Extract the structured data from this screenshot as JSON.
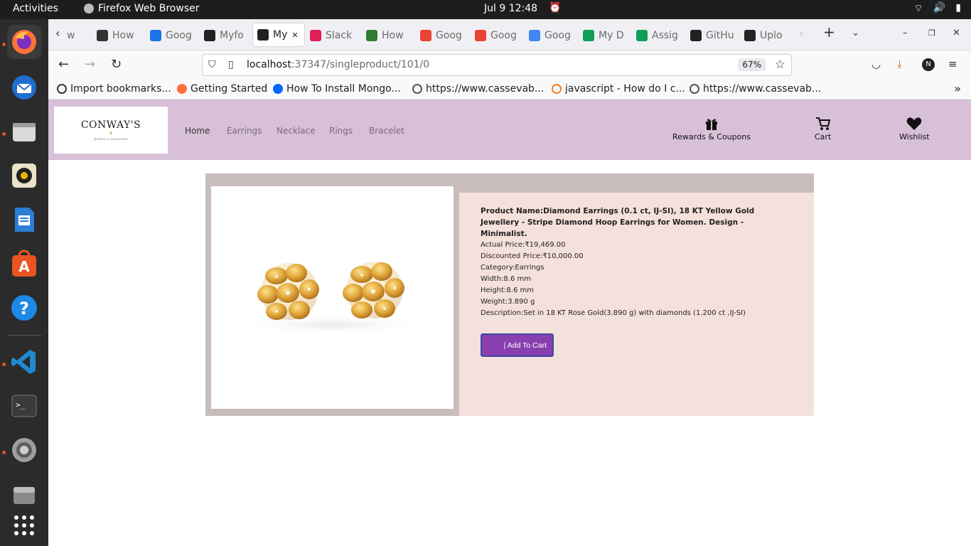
{
  "system": {
    "activities": "Activities",
    "app_name": "Firefox Web Browser",
    "clock": "Jul 9  12:48"
  },
  "browser": {
    "tabs": [
      {
        "label": "w",
        "icon": "chevron-left-icon",
        "color": "#f0f0f4"
      },
      {
        "label": "How",
        "icon": "hex-icon",
        "color": "#333333"
      },
      {
        "label": "Goog",
        "icon": "meet-icon",
        "color": "#1a73e8"
      },
      {
        "label": "Myfo",
        "icon": "angular-icon",
        "color": "#222222"
      },
      {
        "label": "My",
        "icon": "angular-icon",
        "color": "#222222",
        "active": true
      },
      {
        "label": "Slack",
        "icon": "slack-icon",
        "color": "#e01e5a"
      },
      {
        "label": "How",
        "icon": "dg-icon",
        "color": "#2e7d32"
      },
      {
        "label": "Goog",
        "icon": "chrome-icon",
        "color": "#ea4335"
      },
      {
        "label": "Goog",
        "icon": "chrome-icon",
        "color": "#ea4335"
      },
      {
        "label": "Goog",
        "icon": "google-icon",
        "color": "#4285f4"
      },
      {
        "label": "My D",
        "icon": "drive-icon",
        "color": "#0f9d58"
      },
      {
        "label": "Assig",
        "icon": "sheets-icon",
        "color": "#0f9d58"
      },
      {
        "label": "GitHu",
        "icon": "github-icon",
        "color": "#222222"
      },
      {
        "label": "Uplo",
        "icon": "github-icon",
        "color": "#222222"
      }
    ],
    "url_host": "localhost",
    "url_path": ":37347/singleproduct/101/0",
    "zoom": "67%",
    "bookmarks": [
      {
        "label": "Import bookmarks...",
        "icon": "import-icon",
        "color": "#333333"
      },
      {
        "label": "Getting Started",
        "icon": "firefox-icon",
        "color": "#ff7139"
      },
      {
        "label": "How To Install Mongo...",
        "icon": "digitalocean-icon",
        "color": "#0069ff"
      },
      {
        "label": "https://www.cassevab...",
        "icon": "globe-icon",
        "color": "#555555"
      },
      {
        "label": "javascript - How do I c...",
        "icon": "stackoverflow-icon",
        "color": "#f48024"
      },
      {
        "label": "https://www.cassevab...",
        "icon": "globe-icon",
        "color": "#555555"
      }
    ]
  },
  "site": {
    "logo_brand": "CONWAY'S",
    "logo_tagline": "JEWELS & DIAMONDS",
    "menu": [
      "Home",
      "Earrings",
      "Necklace",
      "Rings",
      "Bracelet"
    ],
    "actions": {
      "rewards": "Rewards & Coupons",
      "cart": "Cart",
      "wishlist": "Wishlist"
    }
  },
  "product": {
    "title": "Product Name:Diamond Earrings (0.1 ct, IJ-SI), 18 KT Yellow Gold Jewellery - Stripe Diamond Hoop Earrings for Women. Design - Minimalist.",
    "actual_price": "Actual Price:₹19,469.00",
    "discounted_price": "Discounted Price:₹10,000.00",
    "category": "Category:Earrings",
    "width": "Width:8.6 mm",
    "height": "Height:8.6 mm",
    "weight": "Weight:3.890 g",
    "description": "Description:Set in 18 KT Rose Gold(3.890 g) with diamonds (1.200 ct ,IJ-SI)",
    "add_to_cart": "| Add To Cart"
  }
}
